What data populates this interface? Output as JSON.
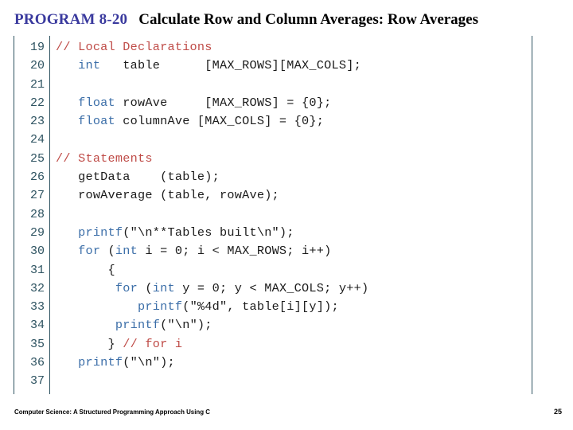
{
  "title": {
    "program_label": "PROGRAM 8-20",
    "description": "Calculate Row and Column Averages: Row Averages"
  },
  "colors": {
    "program_label": "#3a3a9e",
    "keyword": "#3b6ea8",
    "comment": "#bf4b47",
    "line_number": "#2e5361",
    "code_text": "#1a1a1a",
    "rule": "#2e5361",
    "background": "#ffffff"
  },
  "code": {
    "language": "C",
    "first_line_number": 19,
    "last_line_number": 37,
    "lines": [
      {
        "n": "19",
        "tokens": [
          {
            "t": "// Local Declarations",
            "c": "cm"
          }
        ]
      },
      {
        "n": "20",
        "tokens": [
          {
            "t": "   ",
            "c": ""
          },
          {
            "t": "int",
            "c": "kw"
          },
          {
            "t": "   table      [MAX_ROWS][MAX_COLS];",
            "c": ""
          }
        ]
      },
      {
        "n": "21",
        "tokens": [
          {
            "t": "",
            "c": ""
          }
        ]
      },
      {
        "n": "22",
        "tokens": [
          {
            "t": "   ",
            "c": ""
          },
          {
            "t": "float",
            "c": "kw"
          },
          {
            "t": " rowAve     [MAX_ROWS] = {0};",
            "c": ""
          }
        ]
      },
      {
        "n": "23",
        "tokens": [
          {
            "t": "   ",
            "c": ""
          },
          {
            "t": "float",
            "c": "kw"
          },
          {
            "t": " columnAve [MAX_COLS] = {0};",
            "c": ""
          }
        ]
      },
      {
        "n": "24",
        "tokens": [
          {
            "t": "",
            "c": ""
          }
        ]
      },
      {
        "n": "25",
        "tokens": [
          {
            "t": "// Statements",
            "c": "cm"
          }
        ]
      },
      {
        "n": "26",
        "tokens": [
          {
            "t": "   getData    (table);",
            "c": ""
          }
        ]
      },
      {
        "n": "27",
        "tokens": [
          {
            "t": "   rowAverage (table, rowAve);",
            "c": ""
          }
        ]
      },
      {
        "n": "28",
        "tokens": [
          {
            "t": "",
            "c": ""
          }
        ]
      },
      {
        "n": "29",
        "tokens": [
          {
            "t": "   ",
            "c": ""
          },
          {
            "t": "printf",
            "c": "kw"
          },
          {
            "t": "(\"\\n**Tables built\\n\");",
            "c": ""
          }
        ]
      },
      {
        "n": "30",
        "tokens": [
          {
            "t": "   ",
            "c": ""
          },
          {
            "t": "for",
            "c": "kw"
          },
          {
            "t": " (",
            "c": ""
          },
          {
            "t": "int",
            "c": "kw"
          },
          {
            "t": " i = 0; i < MAX_ROWS; i++)",
            "c": ""
          }
        ]
      },
      {
        "n": "31",
        "tokens": [
          {
            "t": "       {",
            "c": ""
          }
        ]
      },
      {
        "n": "32",
        "tokens": [
          {
            "t": "        ",
            "c": ""
          },
          {
            "t": "for",
            "c": "kw"
          },
          {
            "t": " (",
            "c": ""
          },
          {
            "t": "int",
            "c": "kw"
          },
          {
            "t": " y = 0; y < MAX_COLS; y++)",
            "c": ""
          }
        ]
      },
      {
        "n": "33",
        "tokens": [
          {
            "t": "           ",
            "c": ""
          },
          {
            "t": "printf",
            "c": "kw"
          },
          {
            "t": "(\"%4d\", table[i][y]);",
            "c": ""
          }
        ]
      },
      {
        "n": "34",
        "tokens": [
          {
            "t": "        ",
            "c": ""
          },
          {
            "t": "printf",
            "c": "kw"
          },
          {
            "t": "(\"\\n\");",
            "c": ""
          }
        ]
      },
      {
        "n": "35",
        "tokens": [
          {
            "t": "       } ",
            "c": ""
          },
          {
            "t": "// for i",
            "c": "cm"
          }
        ]
      },
      {
        "n": "36",
        "tokens": [
          {
            "t": "   ",
            "c": ""
          },
          {
            "t": "printf",
            "c": "kw"
          },
          {
            "t": "(\"\\n\");",
            "c": ""
          }
        ]
      },
      {
        "n": "37",
        "tokens": [
          {
            "t": "",
            "c": ""
          }
        ]
      }
    ]
  },
  "footer": {
    "book_title": "Computer Science: A Structured Programming Approach Using C",
    "page_number": "25"
  }
}
